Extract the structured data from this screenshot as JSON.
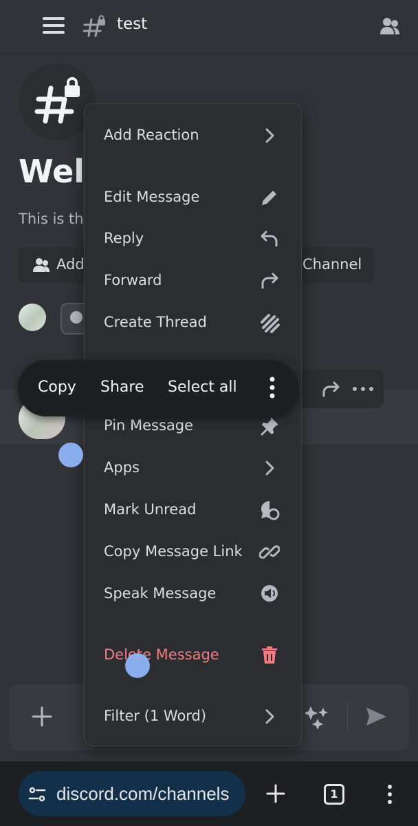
{
  "header": {
    "channel_name": "test"
  },
  "welcome": {
    "title": "Welc                       t!",
    "description": "This is th                                   channel.",
    "add_members_label": "Add",
    "edit_channel_label": "Channel"
  },
  "selection_bar": {
    "copy": "Copy",
    "share": "Share",
    "select_all": "Select all"
  },
  "context_menu": {
    "items": [
      {
        "label": "Add Reaction",
        "icon": "chevron-right-icon"
      },
      {
        "label": "Edit Message",
        "icon": "pencil-icon"
      },
      {
        "label": "Reply",
        "icon": "reply-arrow-icon"
      },
      {
        "label": "Forward",
        "icon": "forward-arrow-icon"
      },
      {
        "label": "Create Thread",
        "icon": "thread-icon"
      },
      {
        "label": "Pin Message",
        "icon": "pin-icon"
      },
      {
        "label": "Apps",
        "icon": "chevron-right-icon"
      },
      {
        "label": "Mark Unread",
        "icon": "mark-unread-icon"
      },
      {
        "label": "Copy Message Link",
        "icon": "link-icon"
      },
      {
        "label": "Speak Message",
        "icon": "speaker-icon"
      },
      {
        "label": "Delete Message",
        "icon": "trash-icon"
      },
      {
        "label": "Filter (1 Word)",
        "icon": "chevron-right-icon"
      }
    ]
  },
  "browser": {
    "url": "discord.com/channels",
    "tab_count": "1"
  },
  "colors": {
    "background": "#313338",
    "menu_background": "#2b2d31",
    "danger": "#f57a80",
    "touch_indicator": "#8fb4f5",
    "url_bar": "#12304a"
  }
}
